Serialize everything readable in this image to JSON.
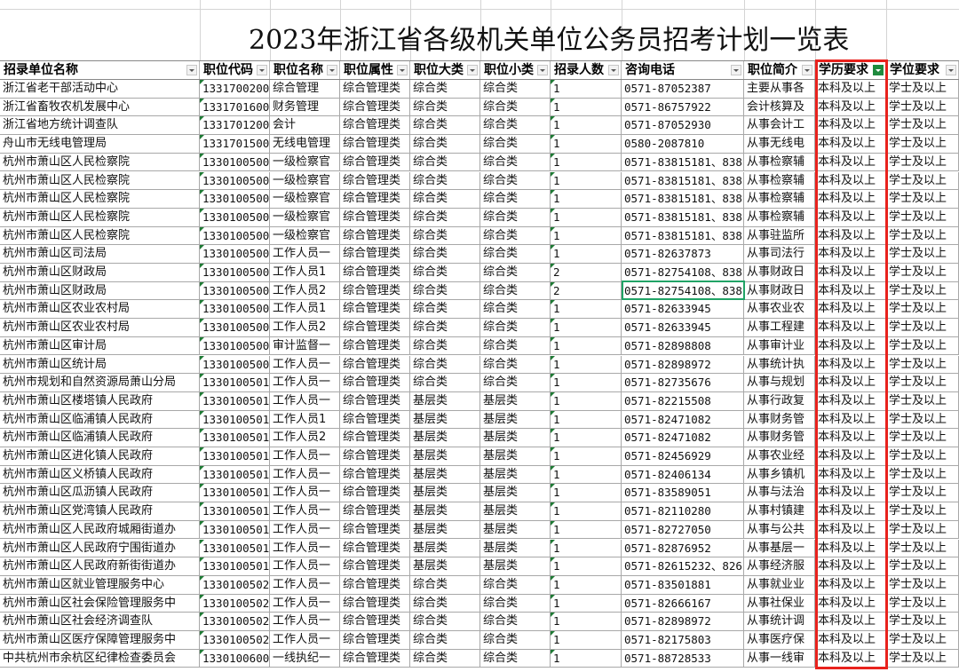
{
  "sheet": {
    "title": "2023年浙江省各级机关单位公务员招考计划一览表",
    "headers": [
      "招录单位名称",
      "职位代码",
      "职位名称",
      "职位属性",
      "职位大类",
      "职位小类",
      "招录人数",
      "咨询电话",
      "职位简介",
      "学历要求",
      "学位要求"
    ],
    "rows": [
      [
        "浙江省老干部活动中心",
        "1331700200",
        "综合管理",
        "综合管理类",
        "综合类",
        "综合类",
        "1",
        "0571-87052387",
        "主要从事各",
        "本科及以上",
        "学士及以上"
      ],
      [
        "浙江省畜牧农机发展中心",
        "1331701600",
        "财务管理",
        "综合管理类",
        "综合类",
        "综合类",
        "1",
        "0571-86757922",
        "会计核算及",
        "本科及以上",
        "学士及以上"
      ],
      [
        "浙江省地方统计调查队",
        "1331701200",
        "会计",
        "综合管理类",
        "综合类",
        "综合类",
        "1",
        "0571-87052930",
        "从事会计工",
        "本科及以上",
        "学士及以上"
      ],
      [
        "舟山市无线电管理局",
        "1331701500",
        "无线电管理",
        "综合管理类",
        "综合类",
        "综合类",
        "1",
        "0580-2087810",
        "从事无线电",
        "本科及以上",
        "学士及以上"
      ],
      [
        "杭州市萧山区人民检察院",
        "1330100500",
        "一级检察官",
        "综合管理类",
        "综合类",
        "综合类",
        "1",
        "0571-83815181、838",
        "从事检察辅",
        "本科及以上",
        "学士及以上"
      ],
      [
        "杭州市萧山区人民检察院",
        "1330100500",
        "一级检察官",
        "综合管理类",
        "综合类",
        "综合类",
        "1",
        "0571-83815181、838",
        "从事检察辅",
        "本科及以上",
        "学士及以上"
      ],
      [
        "杭州市萧山区人民检察院",
        "1330100500",
        "一级检察官",
        "综合管理类",
        "综合类",
        "综合类",
        "1",
        "0571-83815181、838",
        "从事检察辅",
        "本科及以上",
        "学士及以上"
      ],
      [
        "杭州市萧山区人民检察院",
        "1330100500",
        "一级检察官",
        "综合管理类",
        "综合类",
        "综合类",
        "1",
        "0571-83815181、838",
        "从事检察辅",
        "本科及以上",
        "学士及以上"
      ],
      [
        "杭州市萧山区人民检察院",
        "1330100500",
        "一级检察官",
        "综合管理类",
        "综合类",
        "综合类",
        "1",
        "0571-83815181、838",
        "从事驻监所",
        "本科及以上",
        "学士及以上"
      ],
      [
        "杭州市萧山区司法局",
        "1330100500",
        "工作人员一",
        "综合管理类",
        "综合类",
        "综合类",
        "1",
        "0571-82637873",
        "从事司法行",
        "本科及以上",
        "学士及以上"
      ],
      [
        "杭州市萧山区财政局",
        "1330100500",
        "工作人员1",
        "综合管理类",
        "综合类",
        "综合类",
        "2",
        "0571-82754108、838",
        "从事财政日",
        "本科及以上",
        "学士及以上"
      ],
      [
        "杭州市萧山区财政局",
        "1330100500",
        "工作人员2",
        "综合管理类",
        "综合类",
        "综合类",
        "2",
        "0571-82754108、838",
        "从事财政日",
        "本科及以上",
        "学士及以上"
      ],
      [
        "杭州市萧山区农业农村局",
        "1330100500",
        "工作人员1",
        "综合管理类",
        "综合类",
        "综合类",
        "1",
        "0571-82633945",
        "从事农业农",
        "本科及以上",
        "学士及以上"
      ],
      [
        "杭州市萧山区农业农村局",
        "1330100500",
        "工作人员2",
        "综合管理类",
        "综合类",
        "综合类",
        "1",
        "0571-82633945",
        "从事工程建",
        "本科及以上",
        "学士及以上"
      ],
      [
        "杭州市萧山区审计局",
        "1330100500",
        "审计监督一",
        "综合管理类",
        "综合类",
        "综合类",
        "1",
        "0571-82898808",
        "从事审计业",
        "本科及以上",
        "学士及以上"
      ],
      [
        "杭州市萧山区统计局",
        "1330100500",
        "工作人员一",
        "综合管理类",
        "综合类",
        "综合类",
        "1",
        "0571-82898972",
        "从事统计执",
        "本科及以上",
        "学士及以上"
      ],
      [
        "杭州市规划和自然资源局萧山分局",
        "1330100501",
        "工作人员一",
        "综合管理类",
        "综合类",
        "综合类",
        "1",
        "0571-82735676",
        "从事与规划",
        "本科及以上",
        "学士及以上"
      ],
      [
        "杭州市萧山区楼塔镇人民政府",
        "1330100501",
        "工作人员一",
        "综合管理类",
        "基层类",
        "基层类",
        "1",
        "0571-82215508",
        "从事行政复",
        "本科及以上",
        "学士及以上"
      ],
      [
        "杭州市萧山区临浦镇人民政府",
        "1330100501",
        "工作人员1",
        "综合管理类",
        "基层类",
        "基层类",
        "1",
        "0571-82471082",
        "从事财务管",
        "本科及以上",
        "学士及以上"
      ],
      [
        "杭州市萧山区临浦镇人民政府",
        "1330100501",
        "工作人员2",
        "综合管理类",
        "基层类",
        "基层类",
        "1",
        "0571-82471082",
        "从事财务管",
        "本科及以上",
        "学士及以上"
      ],
      [
        "杭州市萧山区进化镇人民政府",
        "1330100501",
        "工作人员一",
        "综合管理类",
        "基层类",
        "基层类",
        "1",
        "0571-82456929",
        "从事农业经",
        "本科及以上",
        "学士及以上"
      ],
      [
        "杭州市萧山区义桥镇人民政府",
        "1330100501",
        "工作人员一",
        "综合管理类",
        "基层类",
        "基层类",
        "1",
        "0571-82406134",
        "从事乡镇机",
        "本科及以上",
        "学士及以上"
      ],
      [
        "杭州市萧山区瓜沥镇人民政府",
        "1330100501",
        "工作人员一",
        "综合管理类",
        "基层类",
        "基层类",
        "1",
        "0571-83589051",
        "从事与法治",
        "本科及以上",
        "学士及以上"
      ],
      [
        "杭州市萧山区党湾镇人民政府",
        "1330100501",
        "工作人员一",
        "综合管理类",
        "基层类",
        "基层类",
        "1",
        "0571-82110280",
        "从事村镇建",
        "本科及以上",
        "学士及以上"
      ],
      [
        "杭州市萧山区人民政府城厢街道办",
        "1330100501",
        "工作人员一",
        "综合管理类",
        "基层类",
        "基层类",
        "1",
        "0571-82727050",
        "从事与公共",
        "本科及以上",
        "学士及以上"
      ],
      [
        "杭州市萧山区人民政府宁围街道办",
        "1330100501",
        "工作人员一",
        "综合管理类",
        "基层类",
        "基层类",
        "1",
        "0571-82876952",
        "从事基层一",
        "本科及以上",
        "学士及以上"
      ],
      [
        "杭州市萧山区人民政府新街街道办",
        "1330100501",
        "工作人员一",
        "综合管理类",
        "基层类",
        "基层类",
        "1",
        "0571-82615232、826",
        "从事经济服",
        "本科及以上",
        "学士及以上"
      ],
      [
        "杭州市萧山区就业管理服务中心",
        "1330100502",
        "工作人员一",
        "综合管理类",
        "综合类",
        "综合类",
        "1",
        "0571-83501881",
        "从事就业业",
        "本科及以上",
        "学士及以上"
      ],
      [
        "杭州市萧山区社会保险管理服务中",
        "1330100502",
        "工作人员一",
        "综合管理类",
        "综合类",
        "综合类",
        "1",
        "0571-82666167",
        "从事社保业",
        "本科及以上",
        "学士及以上"
      ],
      [
        "杭州市萧山区社会经济调查队",
        "1330100502",
        "工作人员一",
        "综合管理类",
        "综合类",
        "综合类",
        "1",
        "0571-82898972",
        "从事统计调",
        "本科及以上",
        "学士及以上"
      ],
      [
        "杭州市萧山区医疗保障管理服务中",
        "1330100502",
        "工作人员一",
        "综合管理类",
        "综合类",
        "综合类",
        "1",
        "0571-82175803",
        "从事医疗保",
        "本科及以上",
        "学士及以上"
      ],
      [
        "中共杭州市余杭区纪律检查委员会",
        "1330100600",
        "一线执纪一",
        "综合管理类",
        "综合类",
        "综合类",
        "1",
        "0571-88728533",
        "从事一线审",
        "本科及以上",
        "学士及以上"
      ]
    ]
  }
}
